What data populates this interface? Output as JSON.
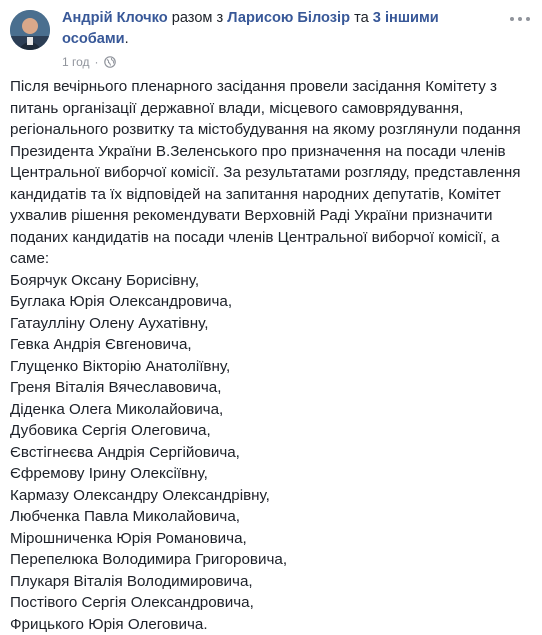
{
  "post": {
    "author": "Андрій Клочко",
    "with_text": "разом з",
    "tagged_person": "Ларисою Білозір",
    "and_text": "та",
    "others_text": "3 іншими особами",
    "period": ".",
    "time": "1 год",
    "dot": "·",
    "privacy_icon": "globe-icon",
    "intro": "Після вечірнього пленарного засідання провели засідання Комітету з питань організації державної влади, місцевого самоврядування, регіонального розвитку та містобудування на якому розглянули подання Президента України В.Зеленського про призначення на посади членів Центральної виборчої комісії. За результатами розгляду, представлення кандидатів та їх відповідей на запитання народних депутатів, Комітет ухвалив рішення рекомендувати Верховній Раді України призначити поданих кандидатів на посади членів Центральної виборчої комісії, а саме:",
    "names": [
      "Боярчук Оксану Борисівну,",
      "Буглака Юрія Олександровича,",
      "Гатаулліну Олену Аухатівну,",
      "Гевка Андрія Євгеновича,",
      "Глущенко Вікторію Анатоліївну,",
      "Греня Віталія Вячеславовича,",
      "Діденка Олега Миколайовича,",
      "Дубовика Сергія Олеговича,",
      "Євстігнеєва Андрія Сергійовича,",
      "Єфремову Ірину Олексіївну,",
      "Кармазу Олександру Олександрівну,",
      "Любченка Павла Миколайовича,",
      "Мірошниченка Юрія Романовича,",
      "Перепелюка Володимира Григоровича,",
      "Плукаря Віталія Володимировича,",
      "Постівого Сергія Олександровича,",
      "Фрицького Юрія Олеговича."
    ]
  },
  "colors": {
    "link": "#385898",
    "text": "#1d2129",
    "muted": "#90949c"
  }
}
